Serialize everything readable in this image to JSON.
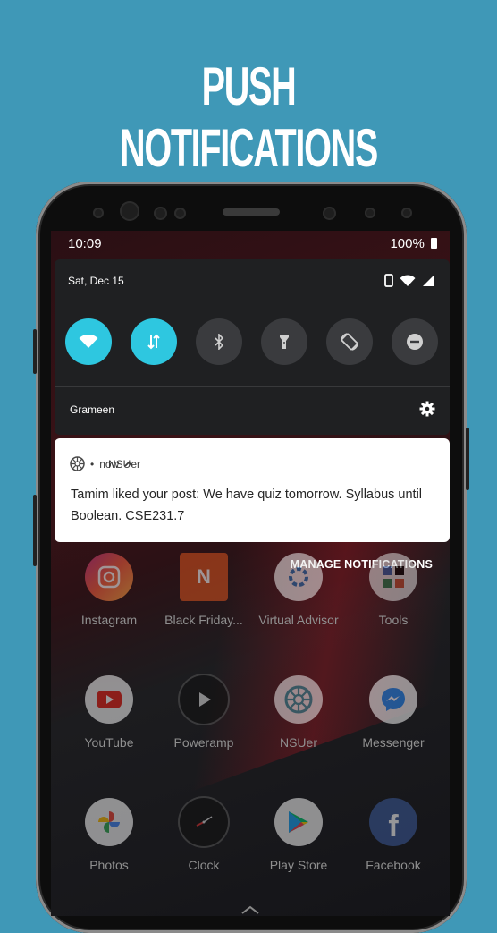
{
  "headline": "PUSH NOTIFICATIONS",
  "status_bar": {
    "time": "10:09",
    "battery": "100%"
  },
  "quick_settings": {
    "date": "Sat, Dec 15",
    "carrier": "Grameen",
    "tiles": [
      {
        "name": "wifi-tile",
        "icon": "wifi-icon",
        "state": "on"
      },
      {
        "name": "data-tile",
        "icon": "mobile-data-icon",
        "state": "on"
      },
      {
        "name": "bluetooth-tile",
        "icon": "bluetooth-icon",
        "state": "off"
      },
      {
        "name": "flashlight-tile",
        "icon": "flashlight-icon",
        "state": "off"
      },
      {
        "name": "auto-rotate-tile",
        "icon": "rotate-icon",
        "state": "off"
      },
      {
        "name": "dnd-tile",
        "icon": "do-not-disturb-icon",
        "state": "off"
      }
    ]
  },
  "notification": {
    "app": "NSUer",
    "separator": "•",
    "time": "now",
    "message": "Tamim liked your post: We have quiz tomorrow. Syllabus until Boolean. CSE231.7"
  },
  "manage_label": "MANAGE NOTIFICATIONS",
  "apps": [
    {
      "label": "Instagram"
    },
    {
      "label": "Black Friday..."
    },
    {
      "label": "Virtual Advisor"
    },
    {
      "label": "Tools"
    },
    {
      "label": "YouTube"
    },
    {
      "label": "Poweramp"
    },
    {
      "label": "NSUer"
    },
    {
      "label": "Messenger"
    },
    {
      "label": "Photos"
    },
    {
      "label": "Clock"
    },
    {
      "label": "Play Store"
    },
    {
      "label": "Facebook"
    }
  ],
  "colors": {
    "background": "#3f98b7",
    "tile_on": "#2ec7e0",
    "tile_off": "#3a3b3e"
  }
}
